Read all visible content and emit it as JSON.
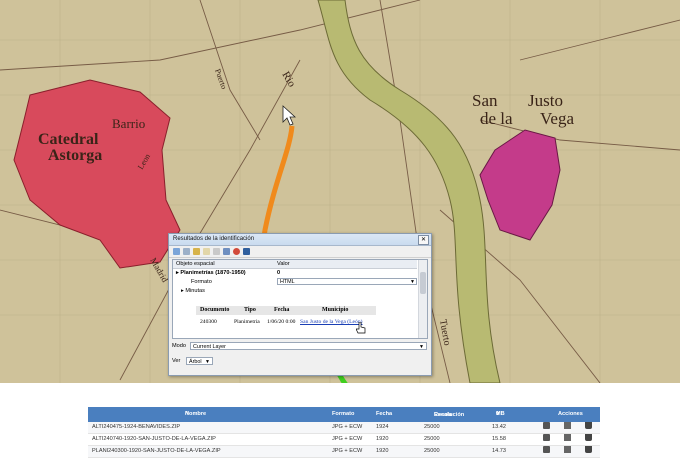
{
  "map": {
    "labels": {
      "city_left_1": "Catedral",
      "city_left_2": "Astorga",
      "barrio": "Barrio",
      "river": "Rio",
      "town_1": "San",
      "town_2": "Justo",
      "town_3": "de la",
      "town_4": "Vega",
      "small_1": "Puerto",
      "small_2": "Madrid",
      "small_3": "Leon",
      "small_4": "Tuerto"
    },
    "colors": {
      "paper": "#cfc29a",
      "urban": "#d84a5c",
      "urban_right": "#c43b8a",
      "river": "#b8ba72",
      "arrow_orange": "#f08a1c",
      "arrow_green": "#3fcf1f"
    }
  },
  "dialog": {
    "title": "Resultados de la identificación",
    "close": "✕",
    "grid_header": {
      "col1": "Objeto espacial",
      "col2": "Valor"
    },
    "layer_row": {
      "name": "Planimetrías (1870-1950)",
      "value": "0"
    },
    "format_row": {
      "name": "Formato",
      "value": "HTML"
    },
    "minutas_row": {
      "name": "Minutas"
    },
    "inner_table": {
      "headers": [
        "Documento",
        "Tipo",
        "Fecha",
        "Municipio"
      ],
      "row": {
        "documento": "240300",
        "tipo": "Planimetria",
        "fecha": "1/06/20 0:00",
        "municipio": "San Justo de la Vega (León)"
      }
    },
    "mode": {
      "label": "Modo",
      "value": "Current Layer"
    },
    "view": {
      "label": "Ver",
      "value": "Árbol"
    }
  },
  "results": {
    "headers": {
      "nombre": "Nombre",
      "formato": "Formato",
      "fecha": "Fecha",
      "resolucion_1": "Resolución /",
      "resolucion_2": "Escala",
      "mb": "MB",
      "acciones": "Acciones"
    },
    "rows": [
      {
        "nombre": "ALTI240475-1924-BENAVIDES.ZIP",
        "formato": "JPG + ECW",
        "fecha": "1924",
        "resolucion": "25000",
        "mb": "13.42"
      },
      {
        "nombre": "ALTI240740-1920-SAN-JUSTO-DE-LA-VEGA.ZIP",
        "formato": "JPG + ECW",
        "fecha": "1920",
        "resolucion": "25000",
        "mb": "15.58"
      },
      {
        "nombre": "PLANI240300-1920-SAN-JUSTO-DE-LA-VEGA.ZIP",
        "formato": "JPG + ECW",
        "fecha": "1920",
        "resolucion": "25000",
        "mb": "14.73"
      }
    ],
    "header_color": "#4a7fbf"
  }
}
